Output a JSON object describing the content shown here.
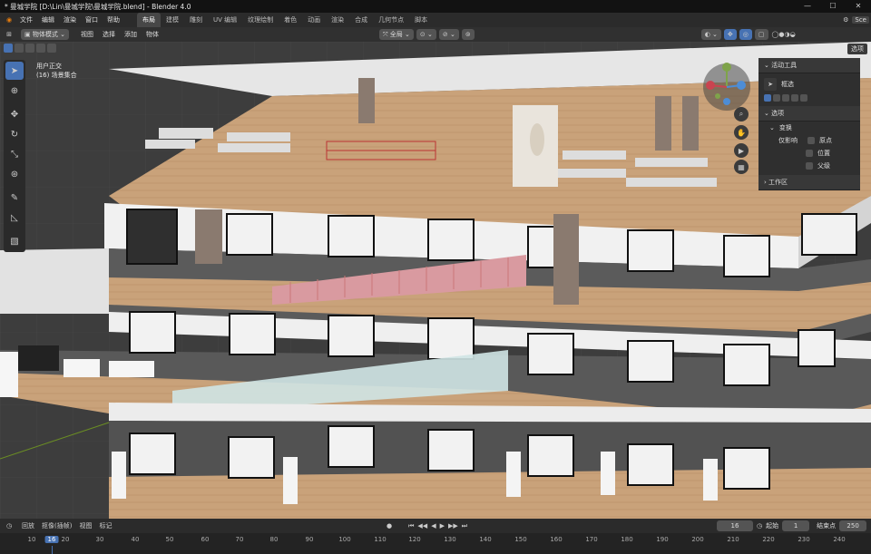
{
  "title_bar": {
    "text": "* 曼城学院 [D:\\Lin\\曼城学院\\曼城学院.blend] - Blender 4.0",
    "controls": [
      "—",
      "☐",
      "✕"
    ]
  },
  "menu": {
    "items": [
      "文件",
      "编辑",
      "渲染",
      "窗口",
      "帮助"
    ],
    "workspaces": [
      "布局",
      "建模",
      "雕刻",
      "UV 编辑",
      "纹理绘制",
      "着色",
      "动画",
      "渲染",
      "合成",
      "几何节点",
      "脚本"
    ],
    "active_workspace": "布局",
    "scene_label": "Sce"
  },
  "header": {
    "mode": "物体模式",
    "menus": [
      "视图",
      "选择",
      "添加",
      "物体"
    ],
    "orientation": "全局",
    "select_btn": "选项"
  },
  "viewport": {
    "view_name": "用户正交",
    "collection": "(16) 场景集合"
  },
  "npanel": {
    "active_tool_title": "活动工具",
    "tool_name": "框选",
    "options_title": "选项",
    "transform_title": "变换",
    "affect_only": "仅影响",
    "opts": [
      "原点",
      "位置",
      "父级"
    ],
    "workspace_title": "工作区"
  },
  "timeline": {
    "menus": [
      "回放",
      "抠像(插帧)",
      "视图",
      "标记"
    ],
    "current_frame": "16",
    "start_label": "起始",
    "start": "1",
    "end_label": "结束点",
    "end": "250",
    "ticks": [
      "10",
      "16",
      "20",
      "30",
      "40",
      "50",
      "60",
      "70",
      "80",
      "90",
      "100",
      "110",
      "120",
      "130",
      "140",
      "150",
      "160",
      "170",
      "180",
      "190",
      "200",
      "210",
      "220",
      "230",
      "240"
    ]
  },
  "colors": {
    "accent": "#4772b3",
    "floor": "#c8a57a",
    "slab": "#e9e9e9"
  }
}
